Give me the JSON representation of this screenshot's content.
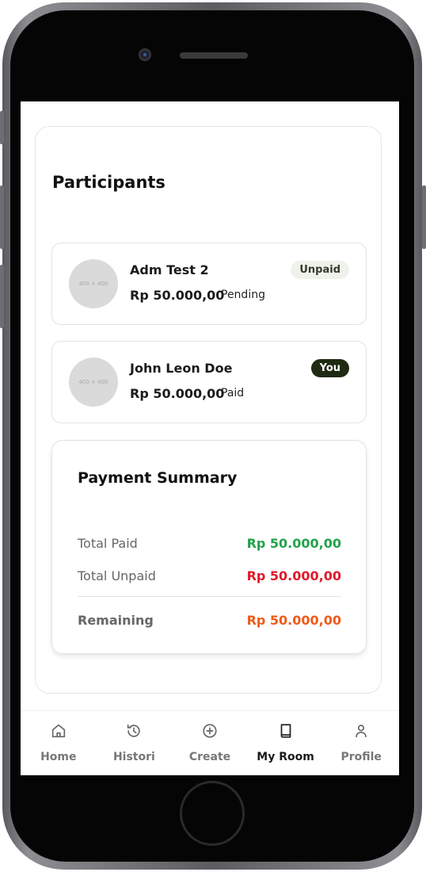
{
  "participants": {
    "title": "Participants",
    "items": [
      {
        "avatar_placeholder": "400 × 400",
        "name": "Adm Test 2",
        "amount": "Rp 50.000,00",
        "status": "Pending",
        "badge": "Unpaid"
      },
      {
        "avatar_placeholder": "400 × 400",
        "name": "John Leon Doe",
        "amount": "Rp 50.000,00",
        "status": "Paid",
        "badge": "You"
      }
    ]
  },
  "payment_summary": {
    "title": "Payment Summary",
    "total_paid_label": "Total Paid",
    "total_paid_value": "Rp 50.000,00",
    "total_unpaid_label": "Total Unpaid",
    "total_unpaid_value": "Rp 50.000,00",
    "remaining_label": "Remaining",
    "remaining_value": "Rp 50.000,00"
  },
  "colors": {
    "paid_green": "#22a24b",
    "unpaid_red": "#e0192b",
    "remaining_orange": "#ee5b1a",
    "you_badge_bg": "#1f2a13",
    "unpaid_badge_bg": "#eef2ea"
  },
  "bottom_nav": {
    "items": [
      {
        "label": "Home",
        "icon": "home-icon",
        "active": false
      },
      {
        "label": "Histori",
        "icon": "history-icon",
        "active": false
      },
      {
        "label": "Create",
        "icon": "plus-circle-icon",
        "active": false
      },
      {
        "label": "My Room",
        "icon": "book-icon",
        "active": true
      },
      {
        "label": "Profile",
        "icon": "user-icon",
        "active": false
      }
    ]
  }
}
